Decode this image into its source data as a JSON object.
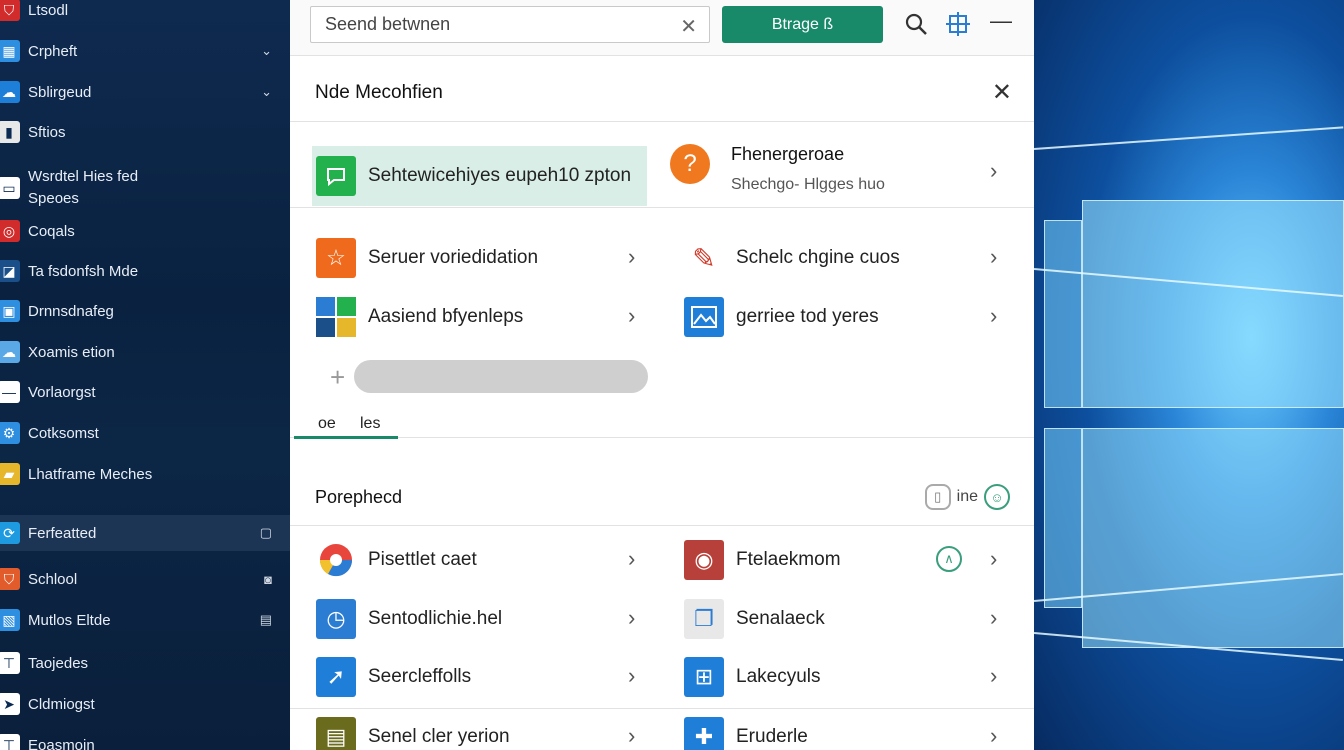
{
  "sidebar": {
    "items": [
      {
        "label": "Ltsodl",
        "icon": "shield-icon",
        "color": "#d22b2b",
        "right": ""
      },
      {
        "label": "Crpheft",
        "icon": "grid-icon",
        "color": "#2e8ee0",
        "right": "⌄"
      },
      {
        "label": "Sblirgeud",
        "icon": "cloud-icon",
        "color": "#1e7fd8",
        "right": "⌄"
      },
      {
        "label": "Sftios",
        "icon": "document-icon",
        "color": "#e8e8e8",
        "right": ""
      },
      {
        "label": "Wsrdtel Hies fed Speoes",
        "icon": "window-icon",
        "color": "#ffffff",
        "right": ""
      },
      {
        "label": "Coqals",
        "icon": "target-icon",
        "color": "#d22b2b",
        "right": ""
      },
      {
        "label": "Ta fsdonfsh Mde",
        "icon": "chart-icon",
        "color": "#1a4f8a",
        "right": ""
      },
      {
        "label": "Drnnsdnafeg",
        "icon": "monitor-icon",
        "color": "#2e8ee0",
        "right": ""
      },
      {
        "label": "Xoamis etion",
        "icon": "cloud-icon",
        "color": "#5aa9e6",
        "right": ""
      },
      {
        "label": "Vorlaorgst",
        "icon": "line-icon",
        "color": "#ffffff",
        "right": ""
      },
      {
        "label": "Cotksomst",
        "icon": "gear-icon",
        "color": "#2e8ee0",
        "right": ""
      },
      {
        "label": "Lhatframe Meches",
        "icon": "folder-icon",
        "color": "#e7b72b",
        "right": ""
      },
      {
        "label": "Ferfeatted",
        "icon": "refresh-icon",
        "color": "#1e9be0",
        "right": "▢"
      },
      {
        "label": "Schlool",
        "icon": "shield-icon",
        "color": "#e25b2b",
        "right": "◙"
      },
      {
        "label": "Mutlos Eltde",
        "icon": "image-icon",
        "color": "#2e8ee0",
        "right": "▤"
      },
      {
        "label": "Taojedes",
        "icon": "bookmark-icon",
        "color": "#ffffff",
        "right": ""
      },
      {
        "label": "Cldmiogst",
        "icon": "pointer-icon",
        "color": "#ffffff",
        "right": ""
      },
      {
        "label": "Eoasmoin",
        "icon": "bookmark-icon",
        "color": "#ffffff",
        "right": ""
      }
    ]
  },
  "topbar": {
    "search_value": "Seend betwnen",
    "clear_icon": "close-icon",
    "primary_button": "Btrage ß",
    "icons": [
      "search-icon",
      "move-icon",
      "minimize-icon"
    ]
  },
  "header": {
    "title": "Nde Mecohfien",
    "close_icon": "close-icon"
  },
  "featured": {
    "label": "Sehtewicehiyes eupeh10 zpton",
    "icon": "chat-icon",
    "color": "#22b14c"
  },
  "help": {
    "title": "Fhenergeroae",
    "subtitle": "Shechgo- Hlgges huo",
    "icon": "question-icon",
    "color": "#f0781e"
  },
  "quick_links": [
    {
      "label": "Seruer voriedidation",
      "icon": "star-icon",
      "color": "#f06a1e"
    },
    {
      "label": "Schelc chgine cuos",
      "icon": "paint-icon",
      "color": "#d23a2a"
    },
    {
      "label": "Aasiend bfyenleps",
      "icon": "windows-tiles-icon",
      "color": "#2b7cd3"
    },
    {
      "label": "gerriee tod yeres",
      "icon": "image-icon",
      "color": "#1f7fd8"
    }
  ],
  "tabs": [
    "oe",
    "les"
  ],
  "section": {
    "title": "Porephecd",
    "tool_text": "ine"
  },
  "apps": [
    {
      "label": "Pisettlet caet",
      "icon": "chrome-icon",
      "color": "#e8453c"
    },
    {
      "label": "Ftelaekmom",
      "icon": "photo-icon",
      "color": "#b7413a"
    },
    {
      "label": "Sentodlichie.hel",
      "icon": "clock-icon",
      "color": "#2b7cd3"
    },
    {
      "label": "Senalaeck",
      "icon": "copy-icon",
      "color": "#2b7cd3"
    },
    {
      "label": "Seercleffolls",
      "icon": "arrow-icon",
      "color": "#1f7fd8"
    },
    {
      "label": "Lakecyuls",
      "icon": "grid-icon",
      "color": "#1f7fd8"
    },
    {
      "label": "Senel cler yerion",
      "icon": "book-icon",
      "color": "#6b6b1e"
    },
    {
      "label": "Eruderle",
      "icon": "puzzle-icon",
      "color": "#1f7fd8"
    }
  ]
}
